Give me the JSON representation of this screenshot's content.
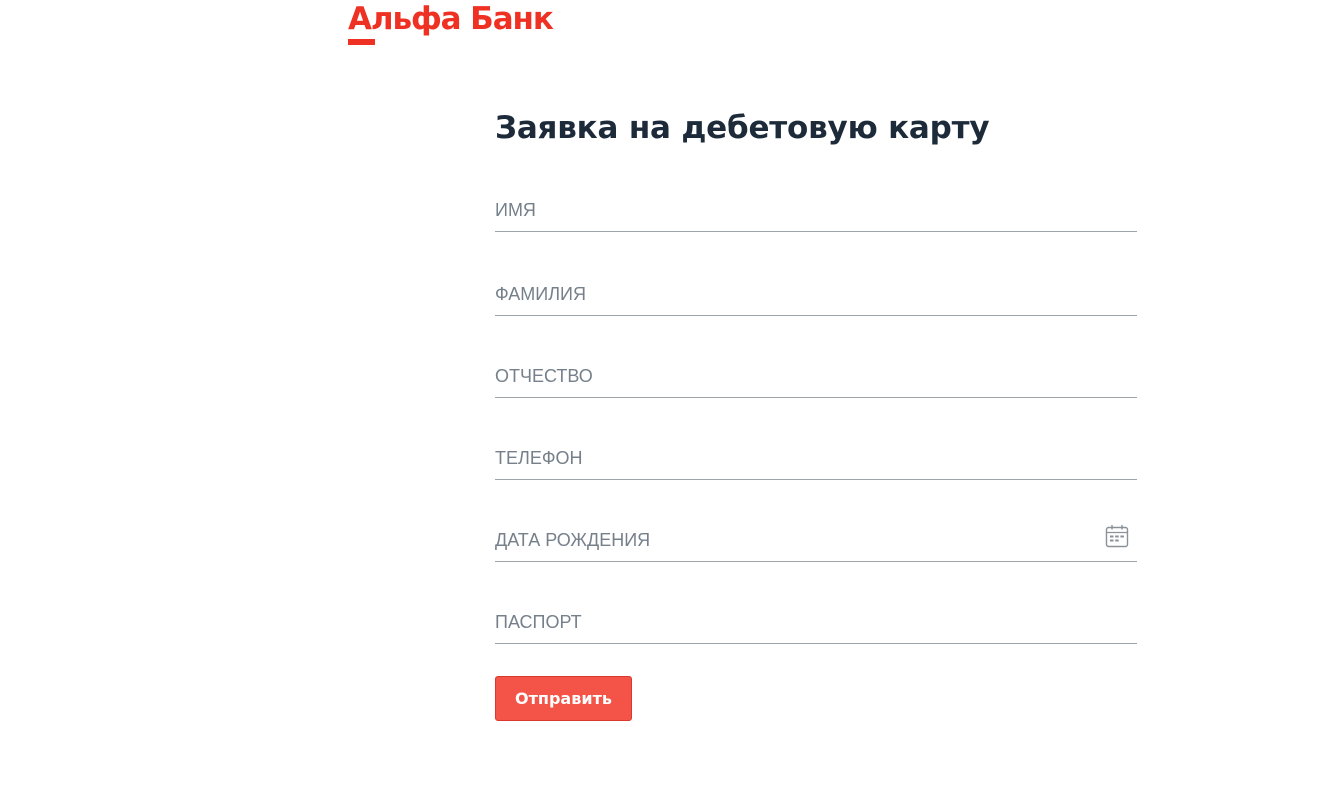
{
  "brand": {
    "logo_text": "Альфа Банк",
    "color": "#ef3124"
  },
  "form": {
    "title": "Заявка на дебетовую карту",
    "fields": [
      {
        "placeholder": "ИМЯ",
        "value": ""
      },
      {
        "placeholder": "ФАМИЛИЯ",
        "value": ""
      },
      {
        "placeholder": "ОТЧЕСТВО",
        "value": ""
      },
      {
        "placeholder": "ТЕЛЕФОН",
        "value": ""
      },
      {
        "placeholder": "ДАТА РОЖДЕНИЯ",
        "value": "",
        "icon": "calendar-icon"
      },
      {
        "placeholder": "ПАСПОРТ",
        "value": ""
      }
    ],
    "submit_label": "Отправить",
    "submit_color": "#f35447"
  }
}
